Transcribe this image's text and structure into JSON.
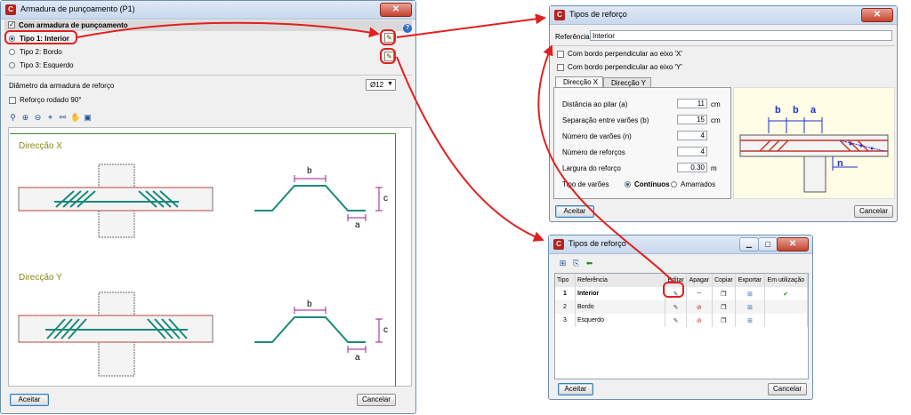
{
  "win1": {
    "title": "Armadura de punçoamento (P1)",
    "close": "✕",
    "header_check_label": "Com armadura de punçoamento",
    "types": [
      "Tipo 1: Interior",
      "Tipo 2: Bordo",
      "Tipo 3: Esquerdo"
    ],
    "diameter_label": "Diâmetro da armadura de reforço",
    "diameter_value": "Ø12",
    "rotated_label": "Reforço rodado 90°",
    "dir_x": "Direcção X",
    "dir_y": "Direcção Y",
    "dim_b": "b",
    "dim_c": "c",
    "dim_a": "a",
    "ok": "Aceitar",
    "cancel": "Cancelar"
  },
  "win2": {
    "title": "Tipos de reforço",
    "close": "✕",
    "ref_label": "Referência",
    "ref_value": "Interior",
    "chk_x": "Com bordo perpendicular ao eixo 'X'",
    "chk_y": "Com bordo perpendicular ao eixo 'Y'",
    "tab_x": "Direcção X",
    "tab_y": "Direcção Y",
    "fields": [
      {
        "label": "Distância ao pilar (a)",
        "value": "11",
        "unit": "cm"
      },
      {
        "label": "Separação entre varões (b)",
        "value": "15",
        "unit": "cm"
      },
      {
        "label": "Número de varões (n)",
        "value": "4",
        "unit": ""
      },
      {
        "label": "Número de reforços",
        "value": "4",
        "unit": ""
      },
      {
        "label": "Largura do reforço",
        "value": "0.30",
        "unit": "m"
      }
    ],
    "bar_type_label": "Tipo de varões",
    "bar_opt1": "Contínuos",
    "bar_opt2": "Amarrados",
    "diag_b": "b",
    "diag_a": "a",
    "diag_n": "n",
    "ok": "Aceitar",
    "cancel": "Cancelar"
  },
  "win3": {
    "title": "Tipos de reforço",
    "close": "✕",
    "headers": [
      "Tipo",
      "Referência",
      "Editar",
      "Apagar",
      "Copiar",
      "Exportar",
      "Em utilização"
    ],
    "rows": [
      {
        "tipo": "1",
        "ref": "Interior",
        "apagar": "--",
        "em_uso": "✔"
      },
      {
        "tipo": "2",
        "ref": "Bordo",
        "apagar": "",
        "em_uso": ""
      },
      {
        "tipo": "3",
        "ref": "Esquerdo",
        "apagar": "",
        "em_uso": ""
      }
    ],
    "ok": "Aceitar",
    "cancel": "Cancelar"
  },
  "colors": {
    "annotation": "#e02020",
    "rebar": "#1a8a7a",
    "purple_dim": "#9a1c8c",
    "title_olive": "#8a8a1a"
  }
}
